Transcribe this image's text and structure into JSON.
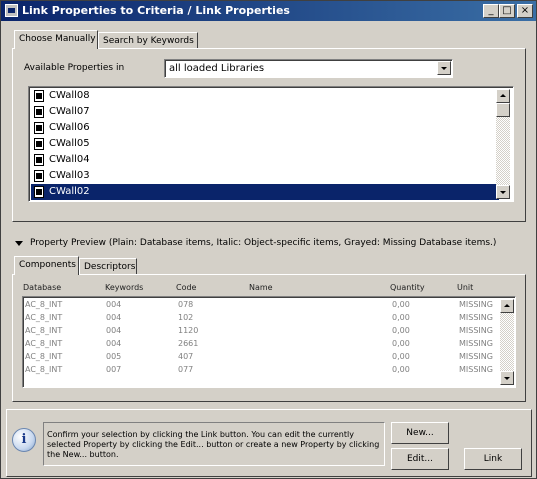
{
  "window": {
    "title": "Link Properties to Criteria / Link Properties",
    "minimize": "_",
    "maximize": "□",
    "close": "×"
  },
  "tabs": [
    {
      "label": "Choose Manually"
    },
    {
      "label": "Search by Keywords"
    }
  ],
  "available": {
    "label": "Available Properties in",
    "selected": "all loaded Libraries",
    "items": [
      {
        "label": "CWall08"
      },
      {
        "label": "CWall07"
      },
      {
        "label": "CWall06"
      },
      {
        "label": "CWall05"
      },
      {
        "label": "CWall04"
      },
      {
        "label": "CWall03"
      },
      {
        "label": "CWall02"
      }
    ]
  },
  "preview": {
    "label": "Property Preview (Plain: Database items, Italic: Object-specific items, Grayed: Missing Database items.)",
    "tabs": [
      {
        "label": "Components"
      },
      {
        "label": "Descriptors"
      }
    ],
    "columns": [
      "Database",
      "Keywords",
      "Code",
      "Name",
      "Quantity",
      "Unit"
    ],
    "rows": [
      {
        "database": "AC_8_INT",
        "keywords": "004",
        "code": "078",
        "name": "",
        "quantity": "0,00",
        "unit": "MISSING"
      },
      {
        "database": "AC_8_INT",
        "keywords": "004",
        "code": "102",
        "name": "",
        "quantity": "0,00",
        "unit": "MISSING"
      },
      {
        "database": "AC_8_INT",
        "keywords": "004",
        "code": "1120",
        "name": "",
        "quantity": "0,00",
        "unit": "MISSING"
      },
      {
        "database": "AC_8_INT",
        "keywords": "004",
        "code": "2661",
        "name": "",
        "quantity": "0,00",
        "unit": "MISSING"
      },
      {
        "database": "AC_8_INT",
        "keywords": "005",
        "code": "407",
        "name": "",
        "quantity": "0,00",
        "unit": "MISSING"
      },
      {
        "database": "AC_8_INT",
        "keywords": "007",
        "code": "077",
        "name": "",
        "quantity": "0,00",
        "unit": "MISSING"
      }
    ]
  },
  "info": {
    "message": "Confirm your selection by clicking the Link button. You can edit the currently selected Property by clicking the Edit... button or create a new Property by clicking the New... button."
  },
  "buttons": {
    "new": "New...",
    "edit": "Edit...",
    "link": "Link"
  }
}
